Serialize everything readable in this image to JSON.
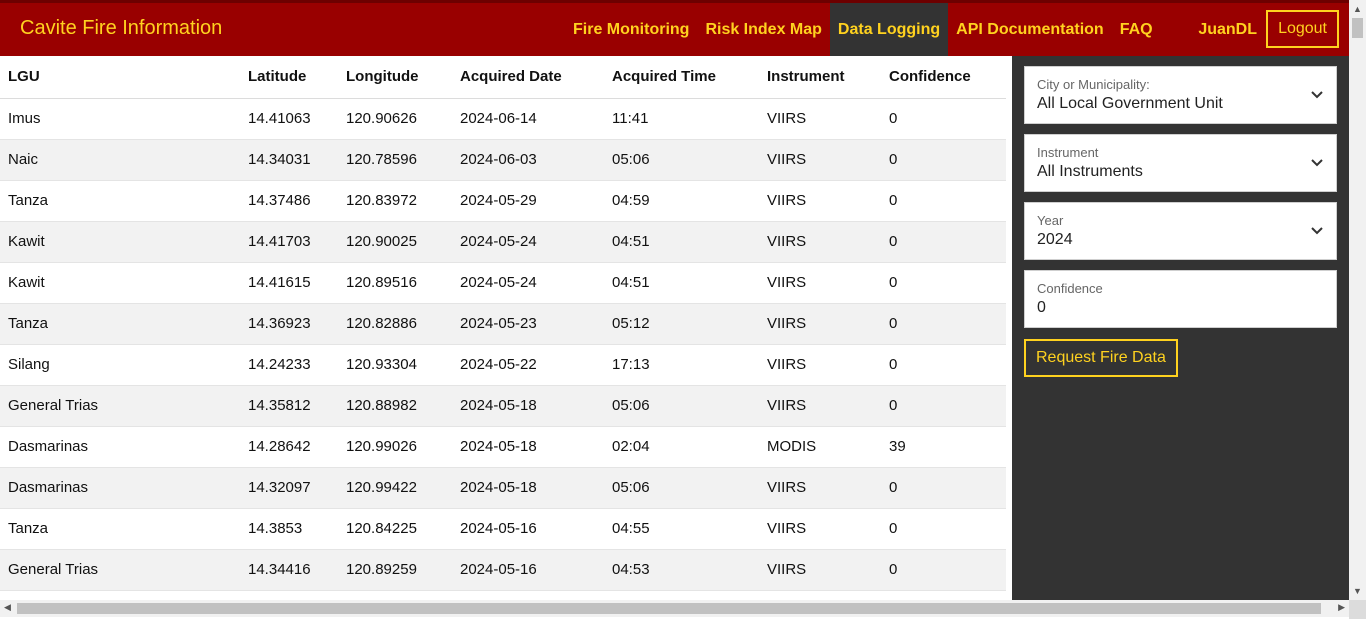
{
  "header": {
    "brand": "Cavite Fire Information",
    "nav": [
      "Fire Monitoring",
      "Risk Index Map",
      "Data Logging",
      "API Documentation",
      "FAQ"
    ],
    "active_nav": "Data Logging",
    "user": "JuanDL",
    "logout": "Logout"
  },
  "table": {
    "columns": [
      "LGU",
      "Latitude",
      "Longitude",
      "Acquired Date",
      "Acquired Time",
      "Instrument",
      "Confidence"
    ],
    "rows": [
      [
        "Imus",
        "14.41063",
        "120.90626",
        "2024-06-14",
        "11:41",
        "VIIRS",
        "0"
      ],
      [
        "Naic",
        "14.34031",
        "120.78596",
        "2024-06-03",
        "05:06",
        "VIIRS",
        "0"
      ],
      [
        "Tanza",
        "14.37486",
        "120.83972",
        "2024-05-29",
        "04:59",
        "VIIRS",
        "0"
      ],
      [
        "Kawit",
        "14.41703",
        "120.90025",
        "2024-05-24",
        "04:51",
        "VIIRS",
        "0"
      ],
      [
        "Kawit",
        "14.41615",
        "120.89516",
        "2024-05-24",
        "04:51",
        "VIIRS",
        "0"
      ],
      [
        "Tanza",
        "14.36923",
        "120.82886",
        "2024-05-23",
        "05:12",
        "VIIRS",
        "0"
      ],
      [
        "Silang",
        "14.24233",
        "120.93304",
        "2024-05-22",
        "17:13",
        "VIIRS",
        "0"
      ],
      [
        "General Trias",
        "14.35812",
        "120.88982",
        "2024-05-18",
        "05:06",
        "VIIRS",
        "0"
      ],
      [
        "Dasmarinas",
        "14.28642",
        "120.99026",
        "2024-05-18",
        "02:04",
        "MODIS",
        "39"
      ],
      [
        "Dasmarinas",
        "14.32097",
        "120.99422",
        "2024-05-18",
        "05:06",
        "VIIRS",
        "0"
      ],
      [
        "Tanza",
        "14.3853",
        "120.84225",
        "2024-05-16",
        "04:55",
        "VIIRS",
        "0"
      ],
      [
        "General Trias",
        "14.34416",
        "120.89259",
        "2024-05-16",
        "04:53",
        "VIIRS",
        "0"
      ]
    ]
  },
  "filters": {
    "city": {
      "label": "City or Municipality:",
      "value": "All Local Government Unit"
    },
    "instrument": {
      "label": "Instrument",
      "value": "All Instruments"
    },
    "year": {
      "label": "Year",
      "value": "2024"
    },
    "confidence": {
      "label": "Confidence",
      "value": "0"
    },
    "request_button": "Request Fire Data"
  },
  "icons": {
    "dropdown": "chevron-down-icon"
  },
  "colors": {
    "header_bg": "#990000",
    "accent": "#ffd21f",
    "sidebar_bg": "#333333"
  }
}
